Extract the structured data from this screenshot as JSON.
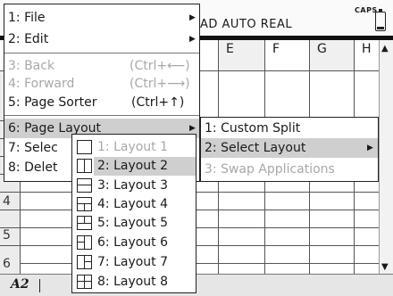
{
  "status": {
    "text": "AD AUTO REAL",
    "caps": "CAPS"
  },
  "columns": [
    "E",
    "F",
    "G",
    "H"
  ],
  "rows": [
    "4",
    "5",
    "6"
  ],
  "entry": {
    "cell_ref": "A2"
  },
  "main_menu": {
    "items": [
      {
        "label": "1: File",
        "disabled": false,
        "submenu": true
      },
      {
        "label": "2: Edit",
        "disabled": false,
        "submenu": true
      },
      {
        "label": "3: Back",
        "shortcut": "(Ctrl+⟵)",
        "disabled": true
      },
      {
        "label": "4: Forward",
        "shortcut": "(Ctrl+⟶)",
        "disabled": true
      },
      {
        "label": "5: Page Sorter",
        "shortcut": "(Ctrl+↑)",
        "disabled": false
      },
      {
        "label": "6: Page Layout",
        "disabled": false,
        "submenu": true,
        "highlight": true
      },
      {
        "label": "7: Selec",
        "disabled": false
      },
      {
        "label": "8: Delet",
        "disabled": false
      }
    ]
  },
  "page_layout_menu": {
    "items": [
      {
        "label": "1: Custom Split",
        "disabled": false
      },
      {
        "label": "2: Select Layout",
        "disabled": false,
        "submenu": true,
        "highlight": true
      },
      {
        "label": "3: Swap Applications",
        "disabled": true
      }
    ]
  },
  "select_layout_menu": {
    "items": [
      {
        "label": "1: Layout 1",
        "icon": "layout-1-icon",
        "disabled": true
      },
      {
        "label": "2: Layout 2",
        "icon": "layout-2-icon",
        "highlight": true
      },
      {
        "label": "3: Layout 3",
        "icon": "layout-3-icon"
      },
      {
        "label": "4: Layout 4",
        "icon": "layout-4-icon"
      },
      {
        "label": "5: Layout 5",
        "icon": "layout-5-icon"
      },
      {
        "label": "6: Layout 6",
        "icon": "layout-6-icon"
      },
      {
        "label": "7: Layout 7",
        "icon": "layout-7-icon"
      },
      {
        "label": "8: Layout 8",
        "icon": "layout-8-icon"
      }
    ]
  },
  "icons": {
    "submenu_arrow": "triangle-right-icon",
    "scroll_up": "triangle-up-icon",
    "scroll_down": "triangle-down-icon",
    "battery": "battery-icon"
  }
}
